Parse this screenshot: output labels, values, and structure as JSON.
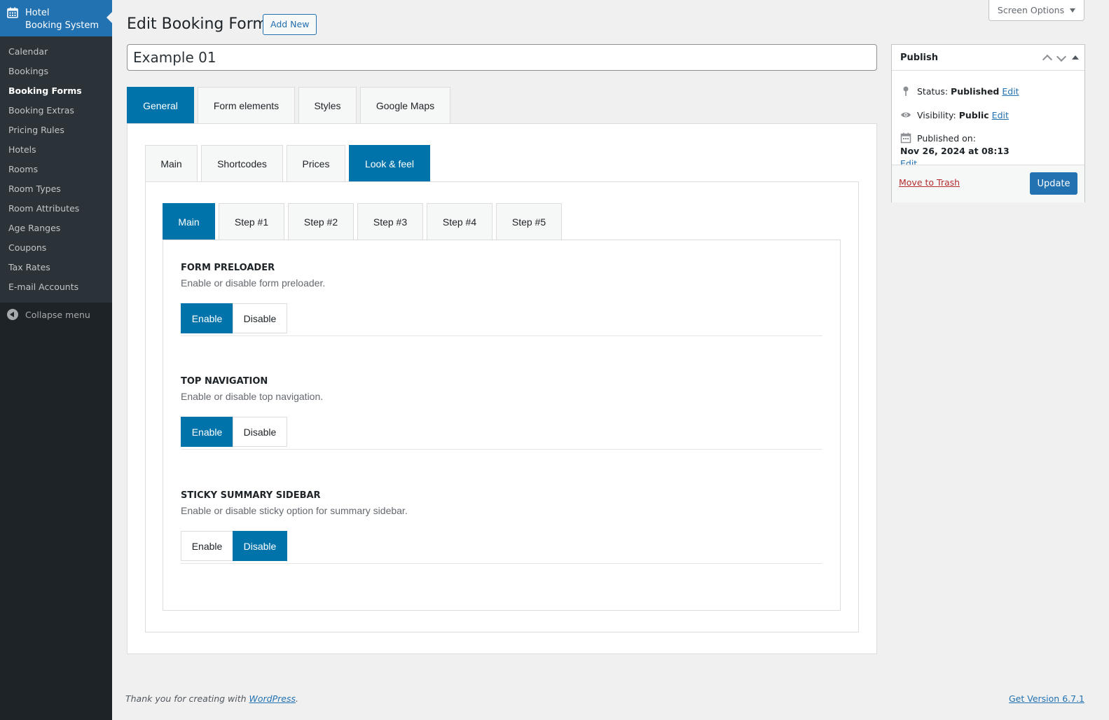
{
  "sidebar": {
    "plugin_title_line1": "Hotel",
    "plugin_title_line2": "Booking System",
    "items": [
      {
        "label": "Calendar"
      },
      {
        "label": "Bookings"
      },
      {
        "label": "Booking Forms"
      },
      {
        "label": "Booking Extras"
      },
      {
        "label": "Pricing Rules"
      },
      {
        "label": "Hotels"
      },
      {
        "label": "Rooms"
      },
      {
        "label": "Room Types"
      },
      {
        "label": "Room Attributes"
      },
      {
        "label": "Age Ranges"
      },
      {
        "label": "Coupons"
      },
      {
        "label": "Tax Rates"
      },
      {
        "label": "E-mail Accounts"
      }
    ],
    "current": "Booking Forms",
    "collapse_label": "Collapse menu"
  },
  "header": {
    "title": "Edit Booking Form",
    "add_new_label": "Add New",
    "screen_options_label": "Screen Options"
  },
  "form_title": "Example 01",
  "tabs_level1": [
    {
      "label": "General",
      "active": true
    },
    {
      "label": "Form elements",
      "active": false
    },
    {
      "label": "Styles",
      "active": false
    },
    {
      "label": "Google Maps",
      "active": false
    }
  ],
  "tabs_level2": [
    {
      "label": "Main",
      "active": false
    },
    {
      "label": "Shortcodes",
      "active": false
    },
    {
      "label": "Prices",
      "active": false
    },
    {
      "label": "Look & feel",
      "active": true
    }
  ],
  "tabs_level3": [
    {
      "label": "Main",
      "active": true
    },
    {
      "label": "Step #1",
      "active": false
    },
    {
      "label": "Step #2",
      "active": false
    },
    {
      "label": "Step #3",
      "active": false
    },
    {
      "label": "Step #4",
      "active": false
    },
    {
      "label": "Step #5",
      "active": false
    }
  ],
  "settings": [
    {
      "title": "FORM PRELOADER",
      "description": "Enable or disable form preloader.",
      "enable_label": "Enable",
      "disable_label": "Disable",
      "value": "Enable"
    },
    {
      "title": "TOP NAVIGATION",
      "description": "Enable or disable top navigation.",
      "enable_label": "Enable",
      "disable_label": "Disable",
      "value": "Enable"
    },
    {
      "title": "STICKY SUMMARY SIDEBAR",
      "description": "Enable or disable sticky option for summary sidebar.",
      "enable_label": "Enable",
      "disable_label": "Disable",
      "value": "Disable"
    }
  ],
  "publish": {
    "title": "Publish",
    "status_label": "Status:",
    "status_value": "Published",
    "visibility_label": "Visibility:",
    "visibility_value": "Public",
    "published_label": "Published on:",
    "published_value": "Nov 26, 2024 at 08:13",
    "edit_label": "Edit",
    "trash_label": "Move to Trash",
    "update_label": "Update"
  },
  "footer": {
    "thanks_prefix": "Thank you for creating with ",
    "thanks_link": "WordPress",
    "thanks_suffix": ".",
    "version": "Get Version 6.7.1"
  },
  "colors": {
    "accent": "#0073aa",
    "admin_blue": "#2271b1",
    "sidebar_bg": "#1d2327",
    "trash_red": "#b32d2e"
  }
}
